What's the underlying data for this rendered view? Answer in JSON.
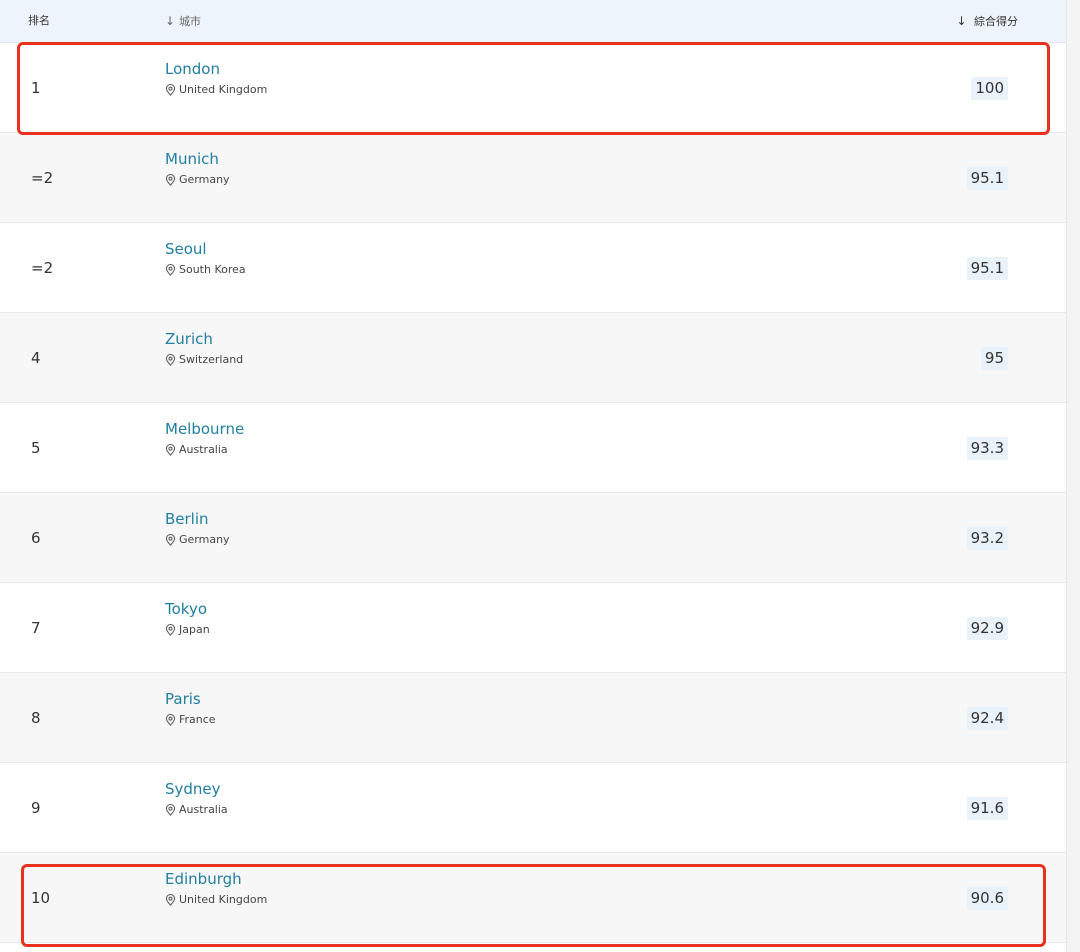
{
  "header": {
    "rank_label": "排名",
    "city_label": "城市",
    "score_label": "綜合得分"
  },
  "rows": [
    {
      "rank": "1",
      "city": "London",
      "country": "United Kingdom",
      "score": "100"
    },
    {
      "rank": "=2",
      "city": "Munich",
      "country": "Germany",
      "score": "95.1"
    },
    {
      "rank": "=2",
      "city": "Seoul",
      "country": "South Korea",
      "score": "95.1"
    },
    {
      "rank": "4",
      "city": "Zurich",
      "country": "Switzerland",
      "score": "95"
    },
    {
      "rank": "5",
      "city": "Melbourne",
      "country": "Australia",
      "score": "93.3"
    },
    {
      "rank": "6",
      "city": "Berlin",
      "country": "Germany",
      "score": "93.2"
    },
    {
      "rank": "7",
      "city": "Tokyo",
      "country": "Japan",
      "score": "92.9"
    },
    {
      "rank": "8",
      "city": "Paris",
      "country": "France",
      "score": "92.4"
    },
    {
      "rank": "9",
      "city": "Sydney",
      "country": "Australia",
      "score": "91.6"
    },
    {
      "rank": "10",
      "city": "Edinburgh",
      "country": "United Kingdom",
      "score": "90.6"
    }
  ],
  "colors": {
    "city_link": "#217fa0",
    "highlight": "#e8321e",
    "header_bg": "#eef4fb",
    "score_bg": "#e9f1f9"
  },
  "icons": {
    "sort": "arrow-down-icon",
    "location": "map-pin-icon"
  }
}
